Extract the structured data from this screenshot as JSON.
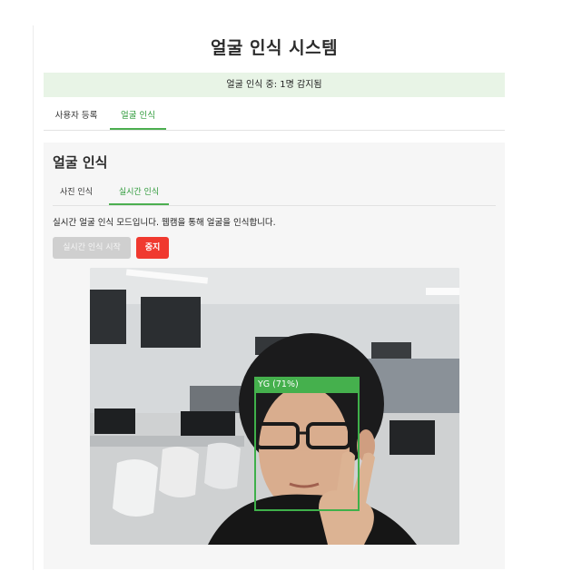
{
  "header": {
    "title": "얼굴 인식 시스템"
  },
  "status": {
    "text": "얼굴 인식 중: 1명 감지됨"
  },
  "main_tabs": [
    {
      "label": "사용자 등록",
      "active": false
    },
    {
      "label": "얼굴 인식",
      "active": true
    }
  ],
  "recognition": {
    "title": "얼굴 인식",
    "sub_tabs": [
      {
        "label": "사진 인식",
        "active": false
      },
      {
        "label": "실시간 인식",
        "active": true
      }
    ],
    "description": "실시간 얼굴 인식 모드입니다. 웹캠을 통해 얼굴을 인식합니다.",
    "start_button": "실시간 인식 시작",
    "start_button_disabled": true,
    "stop_button": "중지"
  },
  "video": {
    "detections": [
      {
        "label": "YG (71%)"
      }
    ]
  },
  "colors": {
    "accent_green": "#4caf50",
    "status_bg": "#e8f4e6",
    "stop_red": "#f0392f",
    "disabled_gray": "#cfcfcf"
  }
}
